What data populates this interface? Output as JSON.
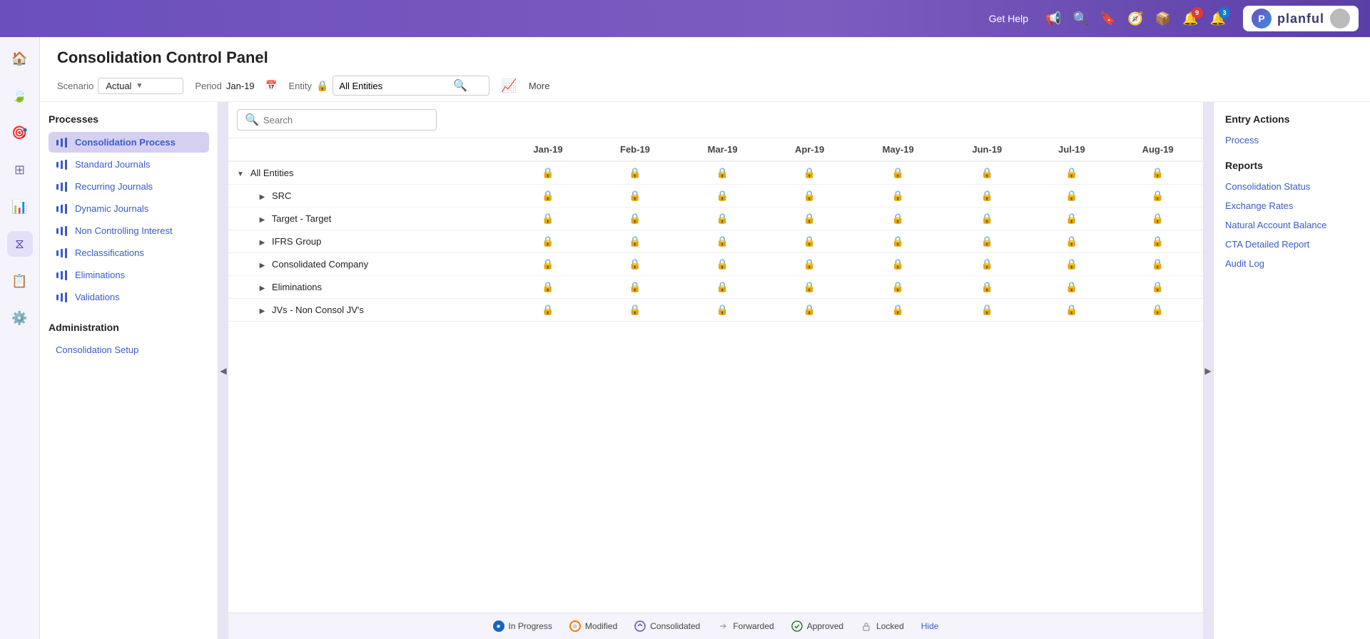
{
  "topNav": {
    "getHelp": "Get Help",
    "brandName": "planful",
    "notifications": "9",
    "badge2": "3"
  },
  "header": {
    "title": "Consolidation Control Panel",
    "scenarioLabel": "Scenario",
    "scenarioValue": "Actual",
    "periodLabel": "Period",
    "periodValue": "Jan-19",
    "entityLabel": "Entity",
    "entityValue": "All Entities",
    "moreLabel": "More"
  },
  "processes": {
    "sectionTitle": "Processes",
    "items": [
      {
        "id": "consolidation-process",
        "label": "Consolidation Process",
        "active": true
      },
      {
        "id": "standard-journals",
        "label": "Standard Journals",
        "active": false
      },
      {
        "id": "recurring-journals",
        "label": "Recurring Journals",
        "active": false
      },
      {
        "id": "dynamic-journals",
        "label": "Dynamic Journals",
        "active": false
      },
      {
        "id": "non-controlling-interest",
        "label": "Non Controlling Interest",
        "active": false
      },
      {
        "id": "reclassifications",
        "label": "Reclassifications",
        "active": false
      },
      {
        "id": "eliminations",
        "label": "Eliminations",
        "active": false
      },
      {
        "id": "validations",
        "label": "Validations",
        "active": false
      }
    ],
    "adminTitle": "Administration",
    "adminItems": [
      {
        "id": "consolidation-setup",
        "label": "Consolidation Setup"
      }
    ]
  },
  "table": {
    "searchPlaceholder": "Search",
    "columns": [
      "Jan-19",
      "Feb-19",
      "Mar-19",
      "Apr-19",
      "May-19",
      "Jun-19",
      "Jul-19",
      "Aug-19"
    ],
    "rows": [
      {
        "name": "All Entities",
        "expandable": true,
        "expanded": true,
        "indent": 0
      },
      {
        "name": "SRC",
        "expandable": true,
        "expanded": false,
        "indent": 1
      },
      {
        "name": "Target - Target",
        "expandable": true,
        "expanded": false,
        "indent": 1
      },
      {
        "name": "IFRS Group",
        "expandable": true,
        "expanded": false,
        "indent": 1
      },
      {
        "name": "Consolidated Company",
        "expandable": true,
        "expanded": false,
        "indent": 1
      },
      {
        "name": "Eliminations",
        "expandable": true,
        "expanded": false,
        "indent": 1
      },
      {
        "name": "JVs - Non Consol JV's",
        "expandable": true,
        "expanded": false,
        "indent": 1
      }
    ]
  },
  "legend": {
    "items": [
      {
        "id": "in-progress",
        "label": "In Progress",
        "icon": "●",
        "color": "blue"
      },
      {
        "id": "modified",
        "label": "Modified",
        "icon": "○",
        "color": "orange"
      },
      {
        "id": "consolidated",
        "label": "Consolidated",
        "icon": "✦",
        "color": "purple"
      },
      {
        "id": "forwarded",
        "label": "Forwarded",
        "icon": "→",
        "color": "fwd"
      },
      {
        "id": "approved",
        "label": "Approved",
        "icon": "✓",
        "color": "approved"
      },
      {
        "id": "locked",
        "label": "Locked",
        "icon": "🔒",
        "color": "locked"
      },
      {
        "id": "hide",
        "label": "Hide",
        "icon": "",
        "color": ""
      }
    ]
  },
  "rightPanel": {
    "entryActionsTitle": "Entry Actions",
    "processLink": "Process",
    "reportsTitle": "Reports",
    "reportLinks": [
      {
        "id": "consolidation-status",
        "label": "Consolidation Status"
      },
      {
        "id": "exchange-rates",
        "label": "Exchange Rates"
      },
      {
        "id": "natural-account-balance",
        "label": "Natural Account Balance"
      },
      {
        "id": "cta-detailed-report",
        "label": "CTA Detailed Report"
      },
      {
        "id": "audit-log",
        "label": "Audit Log"
      }
    ]
  }
}
